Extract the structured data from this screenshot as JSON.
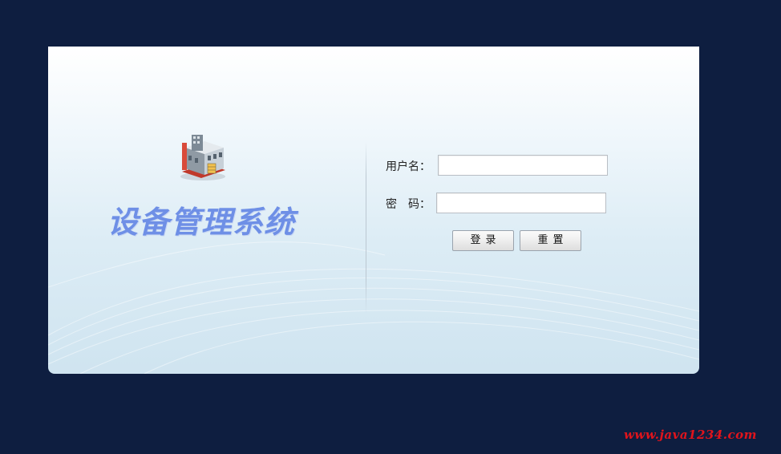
{
  "app": {
    "title": "设备管理系统",
    "logo_icon": "factory-building-icon"
  },
  "login_form": {
    "username_label": "用户名：",
    "username_value": "",
    "password_label": "密　码：",
    "password_value": "",
    "login_button": "登录",
    "reset_button": "重置"
  },
  "watermark": {
    "text": "www.java1234.com"
  },
  "colors": {
    "page_background": "#0e1e40",
    "title_color": "#6e8fe6",
    "watermark_color": "#e0141c"
  }
}
